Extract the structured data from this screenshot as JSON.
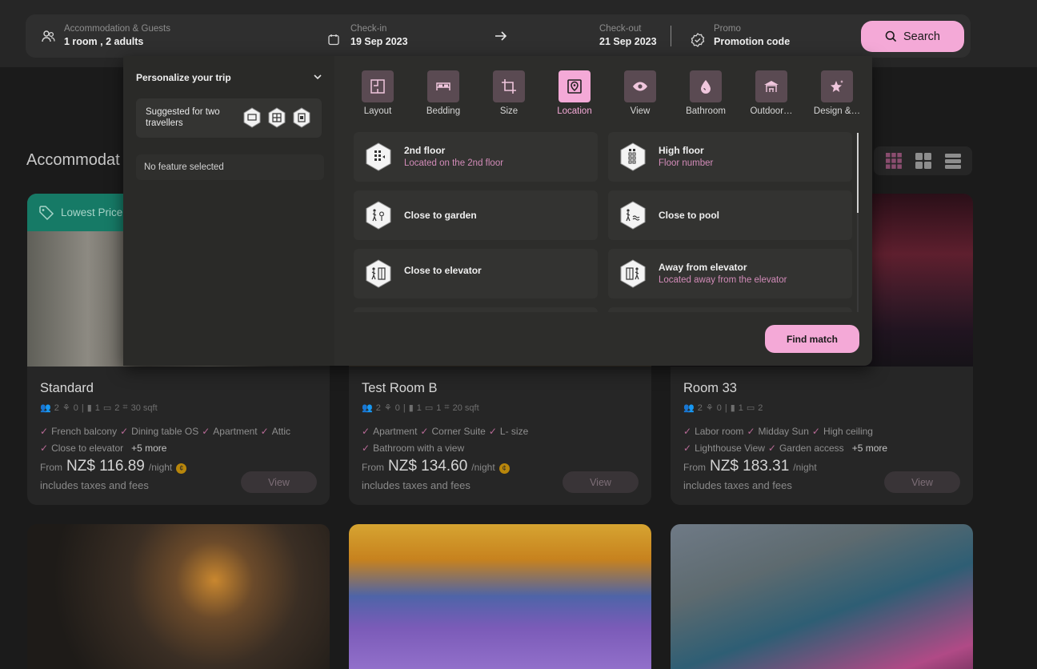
{
  "search_bar": {
    "guests": {
      "label": "Accommodation & Guests",
      "value": "1 room , 2 adults"
    },
    "checkin": {
      "label": "Check-in",
      "value": "19 Sep 2023"
    },
    "checkout": {
      "label": "Check-out",
      "value": "21 Sep 2023"
    },
    "promo": {
      "label": "Promo",
      "value": "Promotion code"
    },
    "search_label": "Search"
  },
  "page": {
    "heading": "Accommodat",
    "lowest_price_badge": "Lowest Price"
  },
  "personalize": {
    "title": "Personalize your trip",
    "suggested": "Suggested for two travellers",
    "no_feature": "No feature selected",
    "categories": [
      {
        "label": "Layout",
        "icon": "layout-icon"
      },
      {
        "label": "Bedding",
        "icon": "bed-icon"
      },
      {
        "label": "Size",
        "icon": "crop-icon"
      },
      {
        "label": "Location",
        "icon": "location-pin-icon",
        "active": true
      },
      {
        "label": "View",
        "icon": "eye-icon"
      },
      {
        "label": "Bathroom",
        "icon": "water-drop-icon"
      },
      {
        "label": "Outdoor…",
        "icon": "pavilion-icon"
      },
      {
        "label": "Design &…",
        "icon": "star-icon"
      }
    ],
    "options": [
      {
        "name": "2nd floor",
        "sub": "Located on the 2nd floor",
        "icon": "floor-icon"
      },
      {
        "name": "High floor",
        "sub": "Floor number",
        "icon": "high-floor-icon"
      },
      {
        "name": "Close to garden",
        "sub": "",
        "icon": "garden-icon"
      },
      {
        "name": "Close to pool",
        "sub": "",
        "icon": "pool-icon"
      },
      {
        "name": "Close to elevator",
        "sub": "",
        "icon": "elevator-icon"
      },
      {
        "name": "Away from elevator",
        "sub": "Located away from the elevator",
        "icon": "away-elevator-icon"
      }
    ],
    "find_label": "Find match"
  },
  "rooms": [
    {
      "title": "Standard",
      "meta": {
        "guests": "2",
        "kids": "0",
        "doors": "1",
        "beds": "2",
        "size": "30 sqft"
      },
      "features_line1": [
        "French balcony",
        "Dining table OS",
        "Apartment",
        "Attic"
      ],
      "features_line2": [
        "Close to elevator"
      ],
      "more": "+5 more",
      "price_from": "From",
      "price": "NZ$ 116.89",
      "per_night": "/night",
      "taxes": "includes taxes and fees",
      "view_label": "View"
    },
    {
      "title": "Test Room B",
      "meta": {
        "guests": "2",
        "kids": "0",
        "doors": "1",
        "beds": "1",
        "size": "20 sqft"
      },
      "features_line1": [
        "Apartment",
        "Corner Suite",
        "L- size"
      ],
      "features_line2": [
        "Bathroom with a view"
      ],
      "more": "",
      "price_from": "From",
      "price": "NZ$ 134.60",
      "per_night": "/night",
      "taxes": "includes taxes and fees",
      "view_label": "View"
    },
    {
      "title": "Room 33",
      "meta": {
        "guests": "2",
        "kids": "0",
        "doors": "1",
        "beds": "2",
        "size": ""
      },
      "features_line1": [
        "Labor room",
        "Midday Sun",
        "High ceiling"
      ],
      "features_line2": [
        "Lighthouse View",
        "Garden access"
      ],
      "more": "+5 more",
      "price_from": "From",
      "price": "NZ$ 183.31",
      "per_night": "/night",
      "taxes": "includes taxes and fees",
      "view_label": "View"
    }
  ],
  "colors": {
    "accent": "#f4a9d7",
    "badge": "#167a66",
    "popup": "#2d2d2b"
  }
}
